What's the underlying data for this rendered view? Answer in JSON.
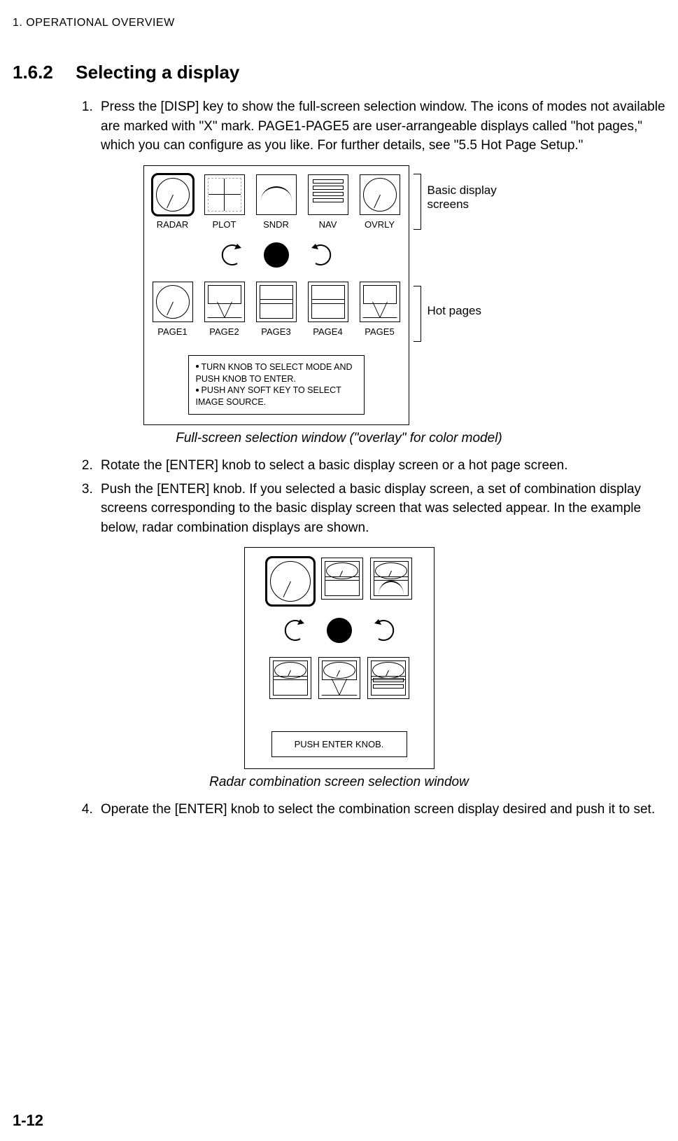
{
  "running_head": "1. OPERATIONAL OVERVIEW",
  "section": {
    "number": "1.6.2",
    "title": "Selecting a display"
  },
  "steps": [
    "Press the [DISP] key to show the full-screen selection window. The icons of modes not available are marked with \"X\" mark. PAGE1-PAGE5 are user-arrangeable displays called \"hot pages,\" which you can configure as you like. For further details, see \"5.5 Hot Page Setup.\"",
    "Rotate the [ENTER] knob to select a basic display screen or a hot page screen.",
    "Push the [ENTER] knob. If you selected a basic display screen, a set of combination display screens corresponding to the basic display screen that was selected appear. In the example below, radar combination displays are shown.",
    "Operate the [ENTER] knob to select the combination screen display desired and push it to set."
  ],
  "fig1": {
    "row1": [
      "RADAR",
      "PLOT",
      "SNDR",
      "NAV",
      "OVRLY"
    ],
    "row2": [
      "PAGE1",
      "PAGE2",
      "PAGE3",
      "PAGE4",
      "PAGE5"
    ],
    "annot_top": "Basic display screens",
    "annot_bot": "Hot pages",
    "instructions": [
      "TURN KNOB TO SELECT MODE AND PUSH KNOB TO ENTER.",
      "PUSH ANY SOFT KEY TO SELECT IMAGE SOURCE."
    ],
    "caption": "Full-screen selection window (\"overlay\" for color model)"
  },
  "fig2": {
    "instruction": "PUSH ENTER KNOB.",
    "caption": "Radar combination screen selection window"
  },
  "page_number": "1-12"
}
